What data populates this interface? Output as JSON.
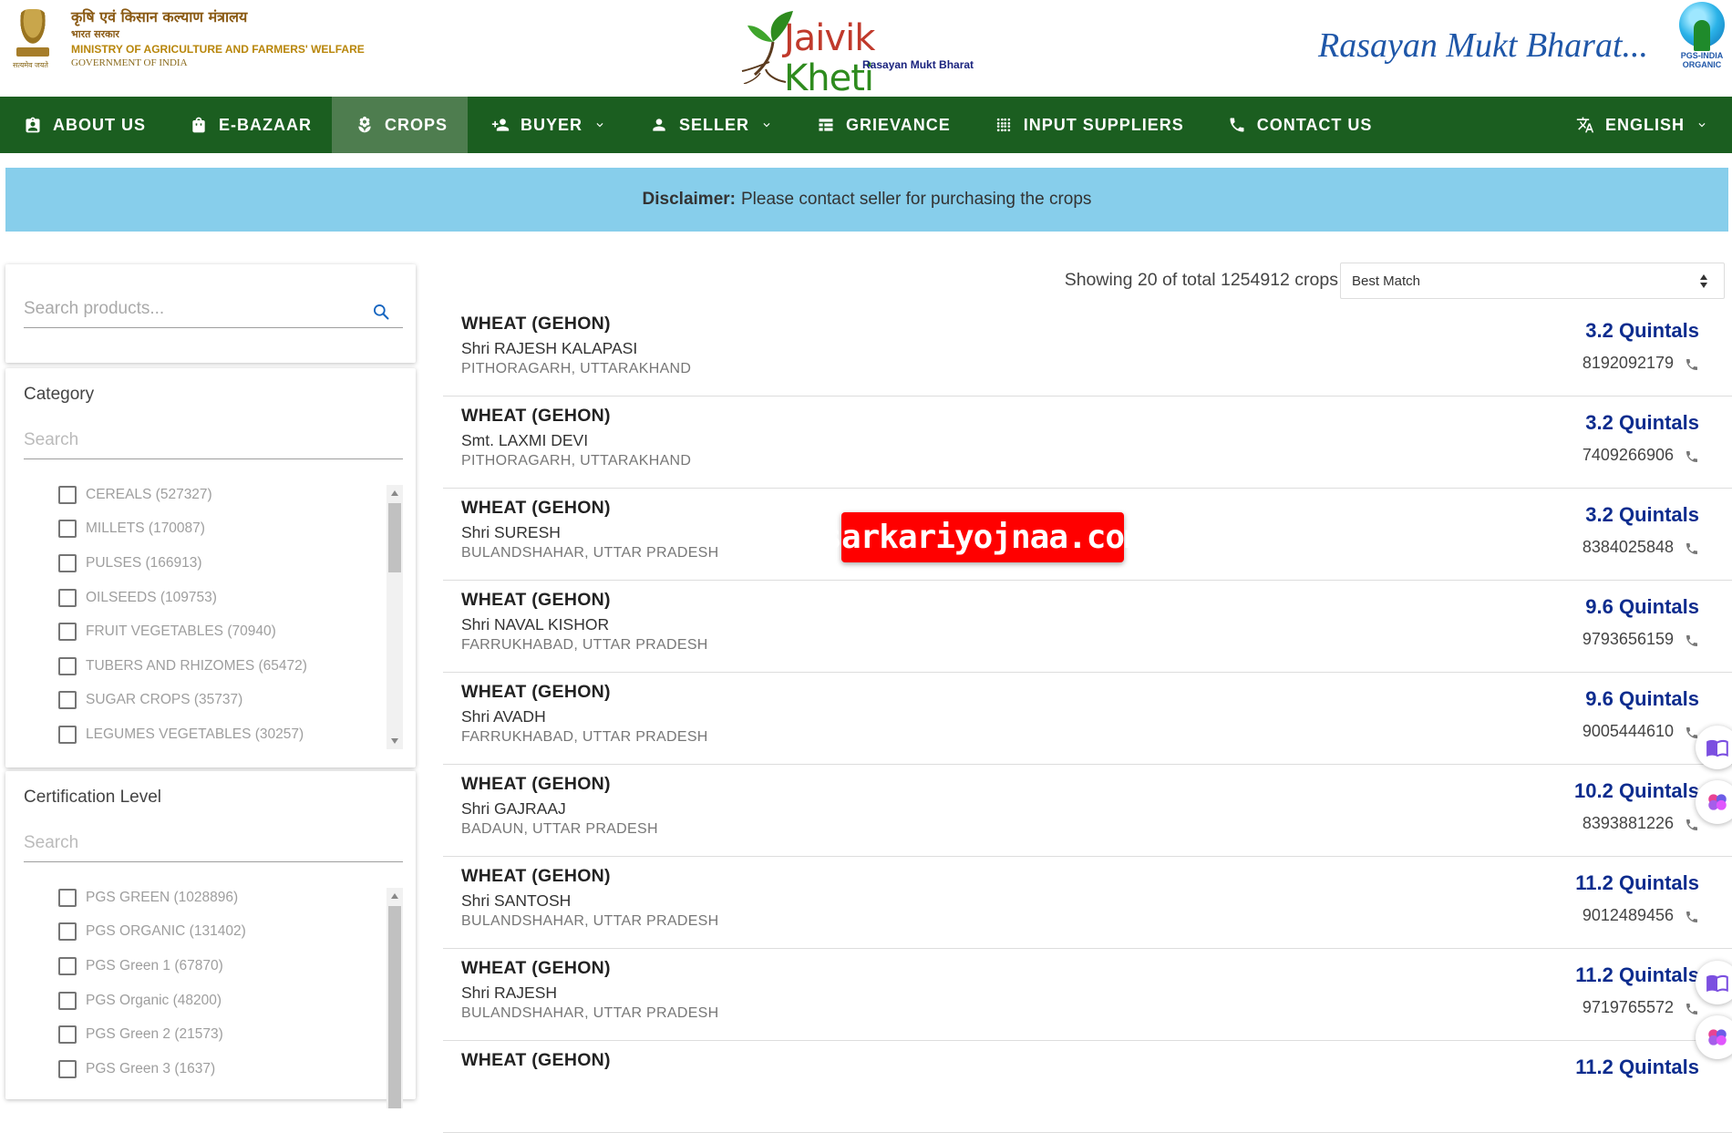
{
  "header": {
    "ministry_hindi": "कृषि एवं किसान कल्याण मंत्रालय",
    "ministry_hindi_sub": "भारत सरकार",
    "ministry_english": "MINISTRY OF AGRICULTURE AND FARMERS' WELFARE",
    "government": "GOVERNMENT OF INDIA",
    "emblem_motto": "सत्यमेव जयते",
    "logo_part1": "Jaivik",
    "logo_part2": " Kheti",
    "logo_sub": "Rasayan Mukt Bharat",
    "tagline": "Rasayan Mukt Bharat...",
    "pgs_text1": "PGS-INDIA",
    "pgs_text2": "ORGANIC"
  },
  "nav": {
    "items": [
      {
        "label": "ABOUT US",
        "icon": "id-badge-icon"
      },
      {
        "label": "E-BAZAAR",
        "icon": "shopping-bag-icon"
      },
      {
        "label": "CROPS",
        "icon": "seedling-icon",
        "active": true
      },
      {
        "label": "BUYER",
        "icon": "person-add-icon",
        "dropdown": true
      },
      {
        "label": "SELLER",
        "icon": "person-icon",
        "dropdown": true
      },
      {
        "label": "GRIEVANCE",
        "icon": "table-icon"
      },
      {
        "label": "INPUT SUPPLIERS",
        "icon": "grid-dots-icon"
      },
      {
        "label": "CONTACT US",
        "icon": "phone-icon"
      }
    ],
    "language": "ENGLISH"
  },
  "disclaimer": {
    "label": "Disclaimer:",
    "text": "Please contact seller for purchasing the crops"
  },
  "sidebar": {
    "search_placeholder": "Search products...",
    "category": {
      "title": "Category",
      "search_placeholder": "Search",
      "items": [
        "CEREALS (527327)",
        "MILLETS (170087)",
        "PULSES (166913)",
        "OILSEEDS (109753)",
        "FRUIT VEGETABLES (70940)",
        "TUBERS AND RHIZOMES (65472)",
        "SUGAR CROPS (35737)",
        "LEGUMES VEGETABLES (30257)"
      ]
    },
    "certification": {
      "title": "Certification Level",
      "search_placeholder": "Search",
      "items": [
        "PGS GREEN (1028896)",
        "PGS ORGANIC (131402)",
        "PGS Green 1 (67870)",
        "PGS Organic (48200)",
        "PGS Green 2 (21573)",
        "PGS Green 3 (1637)"
      ]
    }
  },
  "results": {
    "showing": "Showing 20 of total 1254912 crops",
    "sort_selected": "Best Match",
    "rows": [
      {
        "crop": "WHEAT (GEHON)",
        "seller": "Shri RAJESH KALAPASI",
        "location": "PITHORAGARH, UTTARAKHAND",
        "quantity": "3.2 Quintals",
        "phone": "8192092179"
      },
      {
        "crop": "WHEAT (GEHON)",
        "seller": "Smt. LAXMI DEVI",
        "location": "PITHORAGARH, UTTARAKHAND",
        "quantity": "3.2 Quintals",
        "phone": "7409266906"
      },
      {
        "crop": "WHEAT (GEHON)",
        "seller": "Shri SURESH",
        "location": "BULANDSHAHAR, UTTAR PRADESH",
        "quantity": "3.2 Quintals",
        "phone": "8384025848"
      },
      {
        "crop": "WHEAT (GEHON)",
        "seller": "Shri NAVAL KISHOR",
        "location": "FARRUKHABAD, UTTAR PRADESH",
        "quantity": "9.6 Quintals",
        "phone": "9793656159"
      },
      {
        "crop": "WHEAT (GEHON)",
        "seller": "Shri AVADH",
        "location": "FARRUKHABAD, UTTAR PRADESH",
        "quantity": "9.6 Quintals",
        "phone": "9005444610"
      },
      {
        "crop": "WHEAT (GEHON)",
        "seller": "Shri GAJRAAJ",
        "location": "BADAUN, UTTAR PRADESH",
        "quantity": "10.2 Quintals",
        "phone": "8393881226"
      },
      {
        "crop": "WHEAT (GEHON)",
        "seller": "Shri SANTOSH",
        "location": "BULANDSHAHAR, UTTAR PRADESH",
        "quantity": "11.2 Quintals",
        "phone": "9012489456"
      },
      {
        "crop": "WHEAT (GEHON)",
        "seller": "Shri RAJESH",
        "location": "BULANDSHAHAR, UTTAR PRADESH",
        "quantity": "11.2 Quintals",
        "phone": "9719765572"
      },
      {
        "crop": "WHEAT (GEHON)",
        "seller": "",
        "location": "",
        "quantity": "11.2 Quintals",
        "phone": ""
      }
    ]
  },
  "watermark": "sarkariyojnaa.com",
  "colors": {
    "nav_bg": "#1b5e20",
    "nav_active": "#4e7d4f",
    "disclaimer_bg": "#87ceeb",
    "quantity": "#0d2c8e"
  }
}
